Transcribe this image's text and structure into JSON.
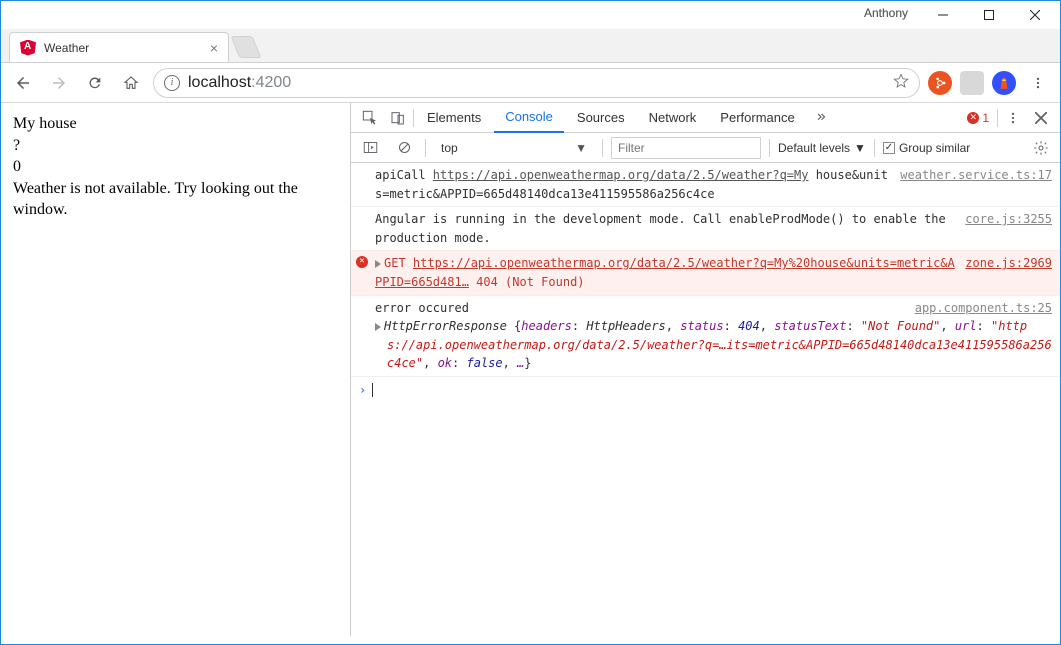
{
  "window": {
    "user": "Anthony"
  },
  "browser": {
    "tab_title": "Weather",
    "url_host": "localhost",
    "url_port": ":4200"
  },
  "page": {
    "l1": "My house",
    "l2": "?",
    "l3": "0",
    "l4": "Weather is not available. Try looking out the window."
  },
  "devtools": {
    "tabs": [
      "Elements",
      "Console",
      "Sources",
      "Network",
      "Performance"
    ],
    "active_tab": "Console",
    "error_count": "1",
    "context": "top",
    "filter_placeholder": "Filter",
    "levels": "Default levels",
    "group_similar": "Group similar",
    "messages": {
      "m1": {
        "prefix": "apiCall ",
        "link1": "https://api.openweathermap.org/data/2.5/weather?q=My",
        "rest": " house&units=metric&APPID=665d48140dca13e411595586a256c4ce",
        "src": "weather.service.ts:17"
      },
      "m2": {
        "text": "Angular is running in the development mode. Call enableProdMode() to enable the production mode.",
        "src": "core.js:3255"
      },
      "m3": {
        "method": "GET ",
        "link": "https://api.openweathermap.org/data/2.5/weather?q=My%20house&units=metric&APPID=665d481…",
        "status": " 404 (Not Found)",
        "src": "zone.js:2969"
      },
      "m4": {
        "prefix": "error occured",
        "src": "app.component.ts:25",
        "obj_cls": "HttpErrorResponse ",
        "k_headers": "headers",
        "v_headers": "HttpHeaders",
        "k_status": "status",
        "v_status": "404",
        "k_statusText": "statusText",
        "v_statusText": "\"Not Found\"",
        "k_url": "url",
        "v_url": "\"https://api.openweathermap.org/data/2.5/weather?q=…its=metric&APPID=665d48140dca13e411595586a256c4ce\"",
        "k_ok": "ok",
        "v_ok": "false",
        "ellipsis": "…"
      }
    }
  }
}
